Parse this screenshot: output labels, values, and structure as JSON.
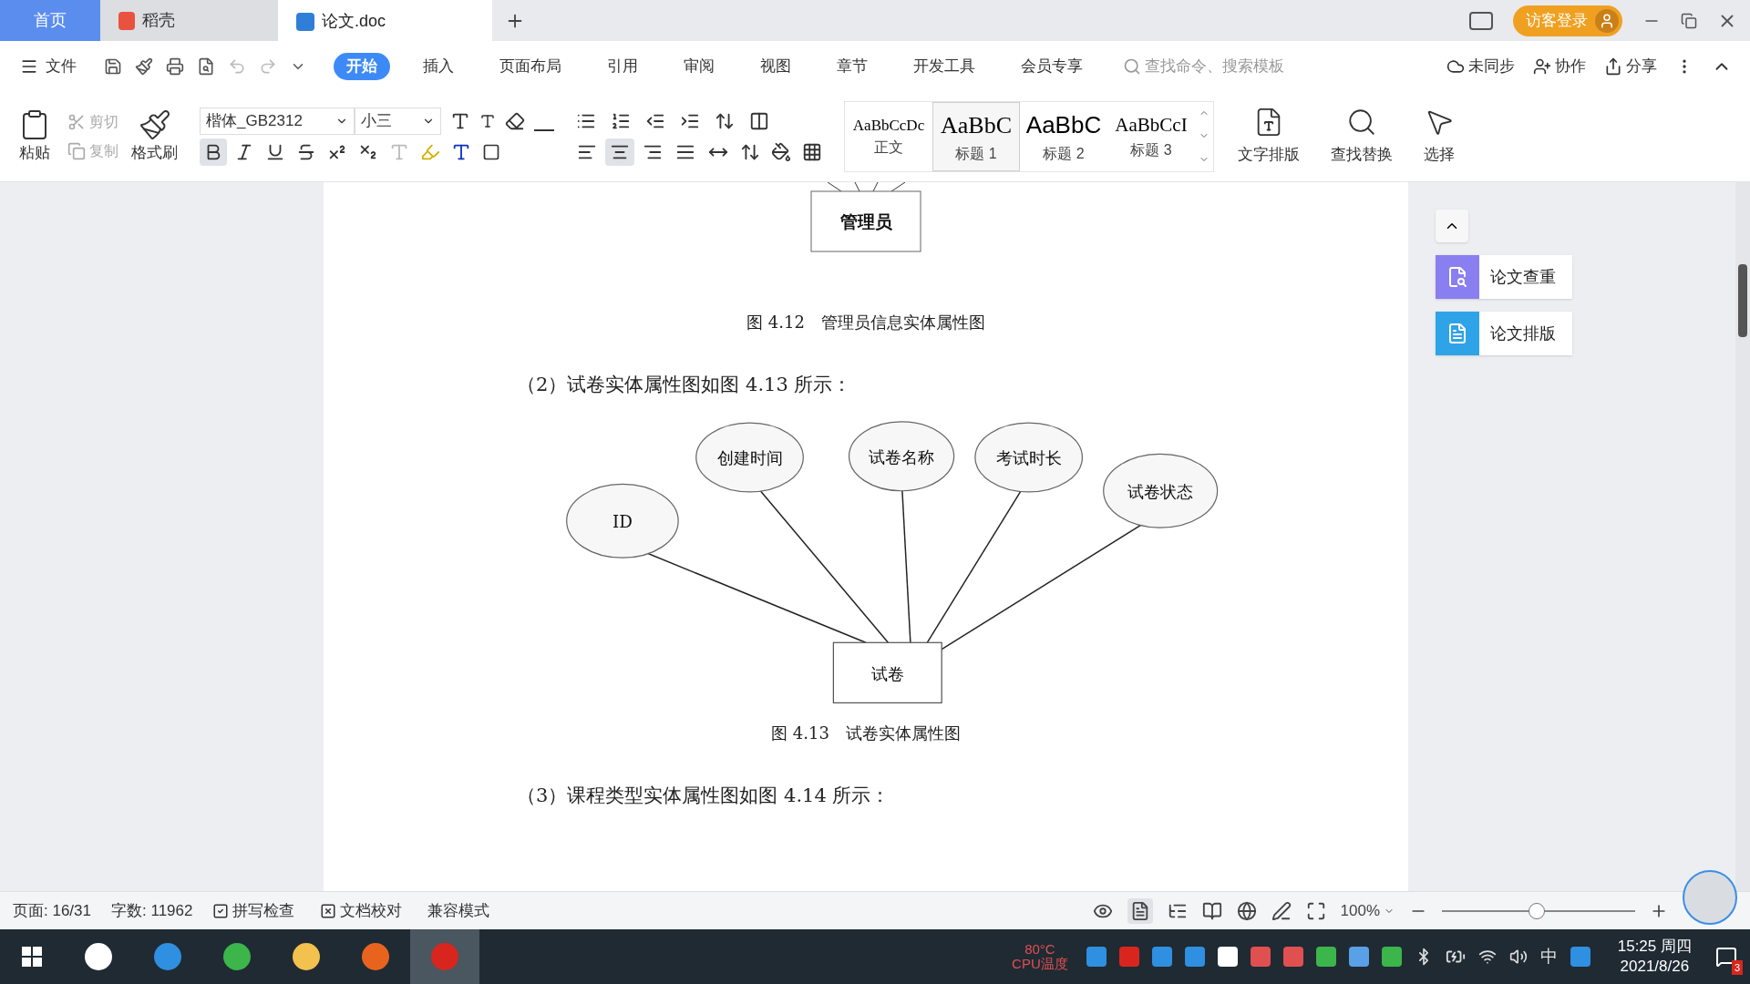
{
  "tabs": [
    {
      "kind": "home",
      "label": "首页",
      "selected": false
    },
    {
      "kind": "app",
      "label": "稻壳",
      "selected": false
    },
    {
      "kind": "doc",
      "label": "论文.doc",
      "selected": true
    }
  ],
  "login_button": "访客登录",
  "file_menu": "文件",
  "ribbon_tabs": [
    {
      "label": "开始",
      "selected": true
    },
    {
      "label": "插入",
      "selected": false
    },
    {
      "label": "页面布局",
      "selected": false
    },
    {
      "label": "引用",
      "selected": false
    },
    {
      "label": "审阅",
      "selected": false
    },
    {
      "label": "视图",
      "selected": false
    },
    {
      "label": "章节",
      "selected": false
    },
    {
      "label": "开发工具",
      "selected": false
    },
    {
      "label": "会员专享",
      "selected": false
    }
  ],
  "search": {
    "placeholder": "查找命令、搜索模板"
  },
  "actions": [
    "未同步",
    "协作",
    "分享"
  ],
  "clipboard": {
    "paste": "粘贴",
    "cut": "剪切",
    "copy": "复制",
    "format_painter": "格式刷"
  },
  "font": {
    "name": "楷体_GB2312",
    "size": "小三"
  },
  "bold": {
    "selected": true
  },
  "alignments": [
    {
      "kind": "left",
      "selected": false
    },
    {
      "kind": "center",
      "selected": true
    },
    {
      "kind": "right",
      "selected": false
    },
    {
      "kind": "justify",
      "selected": false
    },
    {
      "kind": "distributed",
      "selected": false
    }
  ],
  "styles": [
    {
      "preview": "AaBbCcDc",
      "label": "正文",
      "selected": false,
      "kind": "body"
    },
    {
      "preview": "AaBbC",
      "label": "标题 1",
      "selected": true,
      "kind": "h1"
    },
    {
      "preview": "AaBbC",
      "label": "标题 2",
      "selected": false,
      "kind": "h2"
    },
    {
      "preview": "AaBbCcI",
      "label": "标题 3",
      "selected": false,
      "kind": "h3"
    }
  ],
  "big_tools": [
    "文字排版",
    "查找替换",
    "选择"
  ],
  "document": {
    "top_entity": "管理员",
    "caption_1": "图 4.12　管理员信息实体属性图",
    "paragraph_2": "（2）试卷实体属性图如图 4.13 所示：",
    "diagram": {
      "entity": "试卷",
      "attributes": [
        "ID",
        "创建时间",
        "试卷名称",
        "考试时长",
        "试卷状态"
      ]
    },
    "caption_2": "图 4.13　试卷实体属性图",
    "paragraph_3": "（3）课程类型实体属性图如图 4.14 所示："
  },
  "side_panel": [
    "论文查重",
    "论文排版"
  ],
  "status_bar": {
    "page": "页面: 16/31",
    "words": "字数: 11962",
    "spell": "拼写检查",
    "proof": "文档校对",
    "mode": "兼容模式",
    "zoom": "100%",
    "zoom_slider": {
      "level": 0.49
    }
  },
  "taskbar": {
    "cpu_temp": "80°C",
    "cpu_label": "CPU温度",
    "ime": "中",
    "time": "15:25 周四",
    "date": "2021/8/26",
    "notification_count": "3"
  }
}
